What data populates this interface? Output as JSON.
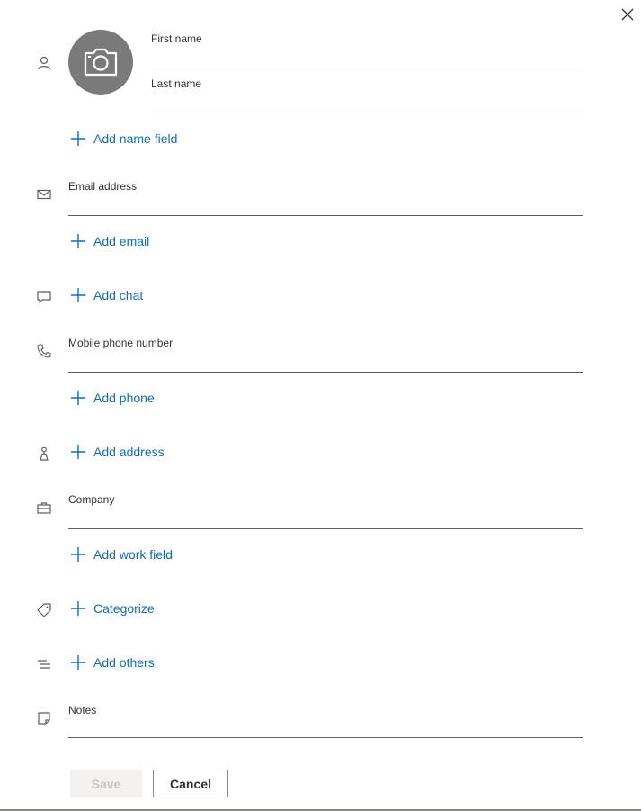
{
  "colors": {
    "accent": "#0f6cbd",
    "avatar_bg": "#7a7a7a",
    "text": "#323130",
    "underline": "#605e5c"
  },
  "header": {
    "close_icon": "close-icon"
  },
  "avatar": {
    "icon": "camera-icon"
  },
  "name_section": {
    "icon": "person-icon",
    "first_name_label": "First name",
    "first_name_value": "",
    "last_name_label": "Last name",
    "last_name_value": "",
    "add_link": "Add name field"
  },
  "email_section": {
    "icon": "mail-icon",
    "label": "Email address",
    "value": "",
    "add_link": "Add email"
  },
  "chat_section": {
    "icon": "chat-icon",
    "add_link": "Add chat"
  },
  "phone_section": {
    "icon": "phone-icon",
    "label": "Mobile phone number",
    "value": "",
    "add_link": "Add phone"
  },
  "address_section": {
    "icon": "location-icon",
    "add_link": "Add address"
  },
  "work_section": {
    "icon": "briefcase-icon",
    "label": "Company",
    "value": "",
    "add_link": "Add work field"
  },
  "category_section": {
    "icon": "tag-icon",
    "add_link": "Categorize"
  },
  "others_section": {
    "icon": "list-icon",
    "add_link": "Add others"
  },
  "notes_section": {
    "icon": "note-icon",
    "label": "Notes",
    "value": ""
  },
  "footer": {
    "save_label": "Save",
    "save_disabled": true,
    "cancel_label": "Cancel"
  }
}
